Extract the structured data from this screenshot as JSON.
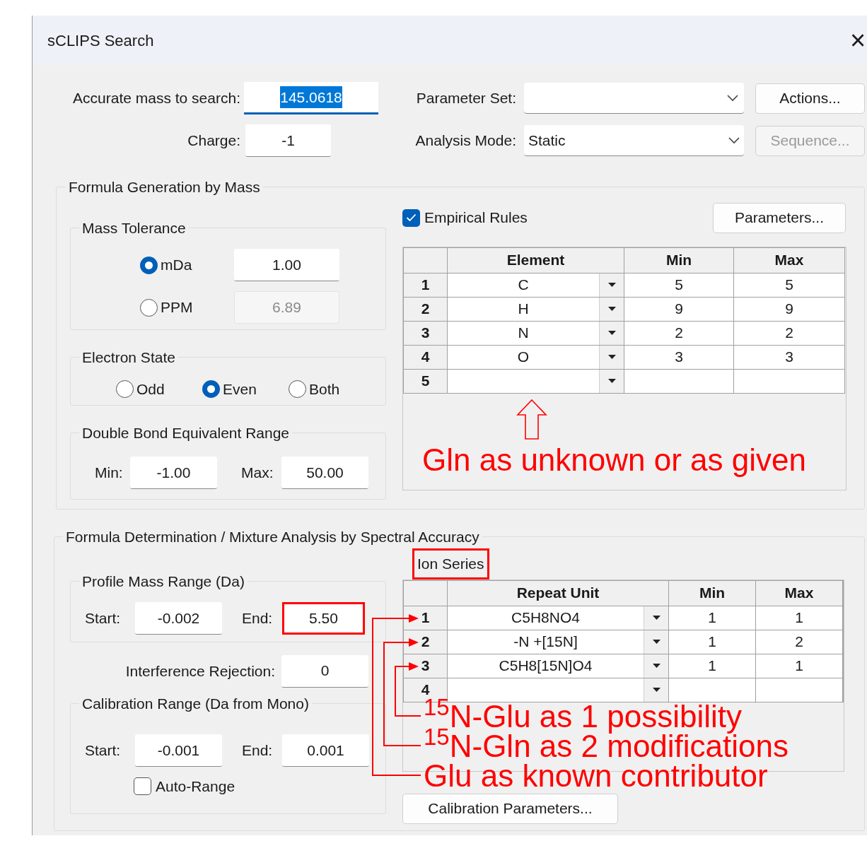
{
  "window": {
    "title": "sCLIPS Search",
    "close": "×"
  },
  "accurate_mass": {
    "label": "Accurate mass to search:",
    "value": "145.0618",
    "focused": true
  },
  "charge": {
    "label": "Charge:",
    "value": "-1"
  },
  "parameter_set": {
    "label": "Parameter Set:"
  },
  "actions_button": {
    "label": "Actions...",
    "disabled": false
  },
  "analysis_mode": {
    "label": "Analysis Mode:",
    "value": "Static"
  },
  "sequence_button": {
    "label": "Sequence...",
    "disabled": true
  },
  "formula_generation": {
    "title": "Formula Generation by Mass",
    "mass_tolerance": {
      "title": "Mass Tolerance",
      "options": [
        {
          "label": "mDa",
          "selected": true,
          "value": "1.00",
          "disabled": false
        },
        {
          "label": "PPM",
          "selected": false,
          "value": "6.89",
          "disabled": true
        }
      ]
    },
    "electron_state": {
      "title": "Electron State",
      "options": [
        {
          "label": "Odd",
          "selected": false
        },
        {
          "label": "Even",
          "selected": true
        },
        {
          "label": "Both",
          "selected": false
        }
      ]
    },
    "dbe_range": {
      "title": "Double Bond Equivalent Range",
      "min_label": "Min:",
      "min": "-1.00",
      "max_label": "Max:",
      "max": "50.00"
    },
    "empirical_rules": {
      "label": "Empirical Rules",
      "checked": true
    },
    "parameters_button": "Parameters...",
    "elements_table": {
      "columns": [
        "Element",
        "Min",
        "Max"
      ],
      "rows": [
        {
          "index": "1",
          "element": "C",
          "min": "5",
          "max": "5"
        },
        {
          "index": "2",
          "element": "H",
          "min": "9",
          "max": "9"
        },
        {
          "index": "3",
          "element": "N",
          "min": "2",
          "max": "2"
        },
        {
          "index": "4",
          "element": "O",
          "min": "3",
          "max": "3"
        },
        {
          "index": "5"
        }
      ]
    },
    "annotation": {
      "kind": "arrow-up",
      "text": "Gln as unknown or as given"
    }
  },
  "formula_determination": {
    "title": "Formula Determination / Mixture Analysis by Spectral Accuracy",
    "profile_mass_range": {
      "title": "Profile Mass Range (Da)",
      "start_label": "Start:",
      "start": "-0.002",
      "end_label": "End:",
      "end": "5.50",
      "end_highlighted": true
    },
    "interference_rejection": {
      "label": "Interference Rejection:",
      "value": "0"
    },
    "calibration_range": {
      "title": "Calibration Range (Da from Mono)",
      "start_label": "Start:",
      "start": "-0.001",
      "end_label": "End:",
      "end": "0.001"
    },
    "auto_range": {
      "label": "Auto-Range",
      "checked": false
    },
    "ion_series": {
      "label": "Ion Series",
      "highlighted": true
    },
    "ion_table": {
      "columns": [
        "Repeat Unit",
        "Min",
        "Max"
      ],
      "rows": [
        {
          "index": "1",
          "unit": "C5H8NO4",
          "min": "1",
          "max": "1"
        },
        {
          "index": "2",
          "unit": "-N +[15N]",
          "min": "1",
          "max": "2"
        },
        {
          "index": "3",
          "unit": "C5H8[15N]O4",
          "min": "1",
          "max": "1"
        },
        {
          "index": "4"
        }
      ]
    },
    "annotations": [
      {
        "text": "$^{15}$N-Glu as 1 possibility"
      },
      {
        "text": "$^{15}$N-Gln as 2 modifications"
      },
      {
        "text": "Glu as known contributor"
      }
    ],
    "calibration_parameters_button": "Calibration Parameters..."
  }
}
